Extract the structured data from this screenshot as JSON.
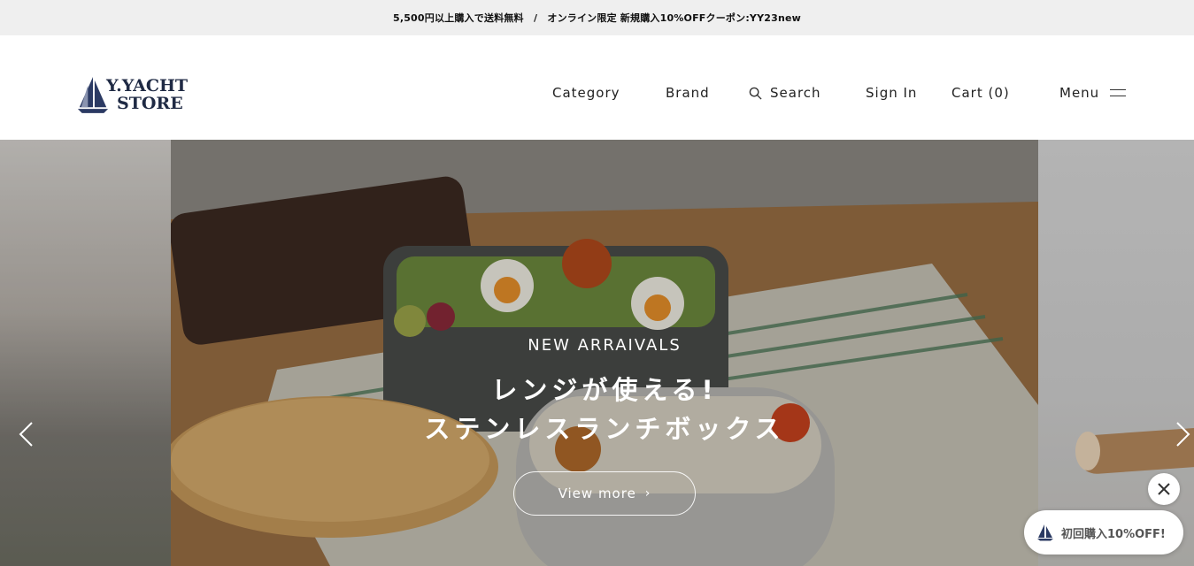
{
  "announcement": {
    "text": "5,500円以上購入で送料無料　/　オンライン限定 新規購入10%OFFクーポン:YY23new"
  },
  "brand": {
    "line1": "Y.YACHT",
    "line2": "STORE",
    "logo_color": "#1f2a44"
  },
  "nav": {
    "category": "Category",
    "brand": "Brand",
    "search": "Search",
    "sign_in": "Sign In",
    "cart": "Cart (0)",
    "menu": "Menu"
  },
  "hero": {
    "eyebrow": "NEW ARRAIVALS",
    "title_line1": "レンジが使える!",
    "title_line2": "ステンレスランチボックス",
    "cta": "View more"
  },
  "icons": {
    "search": "search-icon",
    "menu": "hamburger-icon",
    "prev": "chevron-left-icon",
    "next": "chevron-right-icon",
    "close": "close-icon",
    "logo": "sailboat-icon"
  },
  "coupon": {
    "label": "初回購入10%OFF!"
  }
}
